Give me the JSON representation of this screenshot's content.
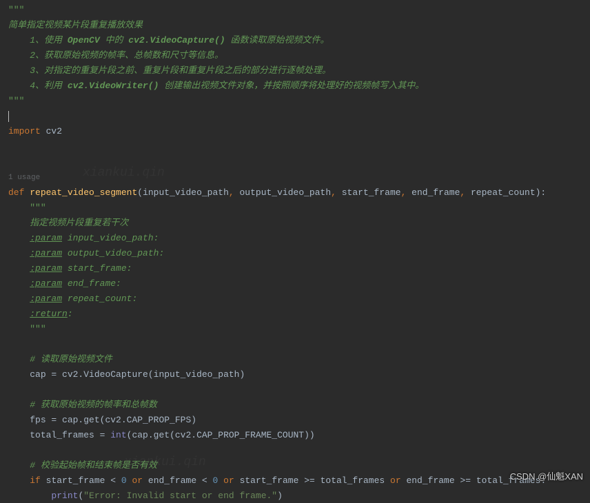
{
  "docstring_top": {
    "open": "\"\"\"",
    "title": "简单指定视频某片段重复播放效果",
    "items": [
      {
        "num": "1、",
        "prefix": "使用 ",
        "api": "OpenCV",
        "mid": " 中的 ",
        "api2": "cv2.VideoCapture()",
        "suffix": " 函数读取原始视频文件。"
      },
      {
        "num": "2、",
        "text": "获取原始视频的帧率、总帧数和尺寸等信息。"
      },
      {
        "num": "3、",
        "text": "对指定的重复片段之前、重复片段和重复片段之后的部分进行逐帧处理。"
      },
      {
        "num": "4、",
        "prefix": "利用 ",
        "api": "cv2.VideoWriter()",
        "suffix": " 创建输出视频文件对象，并按照顺序将处理好的视频帧写入其中。"
      }
    ],
    "close": "\"\"\""
  },
  "import_line": {
    "kw": "import",
    "mod": "cv2"
  },
  "usage_hint": "1 usage",
  "func_def": {
    "kw": "def",
    "name": "repeat_video_segment",
    "params": [
      "input_video_path",
      "output_video_path",
      "start_frame",
      "end_frame",
      "repeat_count"
    ]
  },
  "docstring_func": {
    "open": "\"\"\"",
    "title": "指定视频片段重复若干次",
    "params": [
      {
        "tag": ":param",
        "name": "input_video_path:"
      },
      {
        "tag": ":param",
        "name": "output_video_path:"
      },
      {
        "tag": ":param",
        "name": "start_frame:"
      },
      {
        "tag": ":param",
        "name": "end_frame:"
      },
      {
        "tag": ":param",
        "name": "repeat_count:"
      }
    ],
    "return_tag": ":return",
    "return_colon": ":",
    "close": "\"\"\""
  },
  "comments": {
    "c1": "# 读取原始视频文件",
    "c2": "# 获取原始视频的帧率和总帧数",
    "c3": "# 校验起始帧和结束帧是否有效"
  },
  "code": {
    "cap_line": {
      "lhs": "cap",
      "eq": " = ",
      "rhs": "cv2.VideoCapture(input_video_path)"
    },
    "fps_line": {
      "lhs": "fps",
      "eq": " = ",
      "rhs": "cap.get(cv2.CAP_PROP_FPS)"
    },
    "total_line": {
      "lhs": "total_frames",
      "eq": " = ",
      "builtin": "int",
      "rhs": "(cap.get(cv2.CAP_PROP_FRAME_COUNT))"
    },
    "if_line": {
      "kw_if": "if",
      "p1": "start_frame < ",
      "n1": "0",
      "or": "or",
      "p2": "end_frame < ",
      "n2": "0",
      "p3": "start_frame >= total_frames",
      "p4": "end_frame >= total_frames",
      "colon": ":"
    },
    "print_line": {
      "builtin": "print",
      "open": "(",
      "str": "\"Error: Invalid start or end frame.\"",
      "close": ")"
    }
  },
  "watermark": "CSDN @仙魁XAN"
}
